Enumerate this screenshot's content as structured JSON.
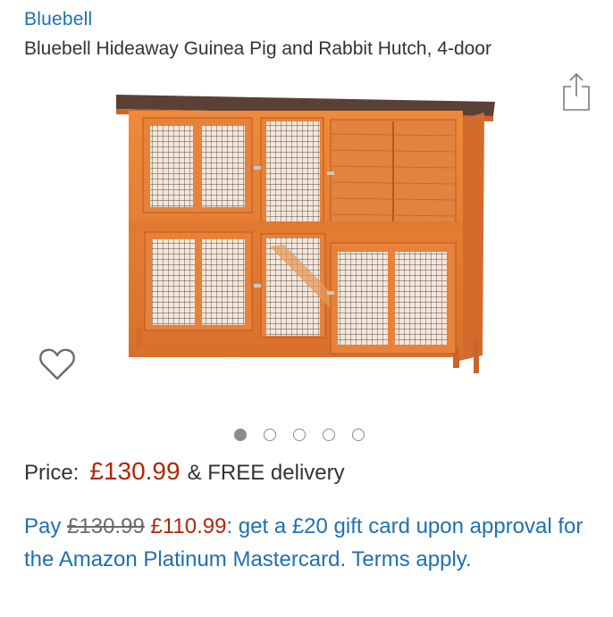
{
  "product": {
    "brand": "Bluebell",
    "title": "Bluebell Hideaway Guinea Pig and Rabbit Hutch, 4-door",
    "image_alt": "Two-tier wooden rabbit hutch with wire mesh doors"
  },
  "carousel": {
    "total": 5,
    "active_index": 0
  },
  "pricing": {
    "label": "Price:",
    "price": "£130.99",
    "delivery": "& FREE delivery"
  },
  "offer": {
    "pay_label": "Pay",
    "old_price": "£130.99",
    "new_price": "£110.99",
    "text": ": get a £20 gift card upon approval for the Amazon Platinum Mastercard. Terms apply."
  },
  "icons": {
    "share": "share-icon",
    "wishlist": "heart-icon"
  },
  "colors": {
    "link_blue": "#1f6fb2",
    "price_red": "#b12704",
    "wood": "#e07a2e"
  }
}
